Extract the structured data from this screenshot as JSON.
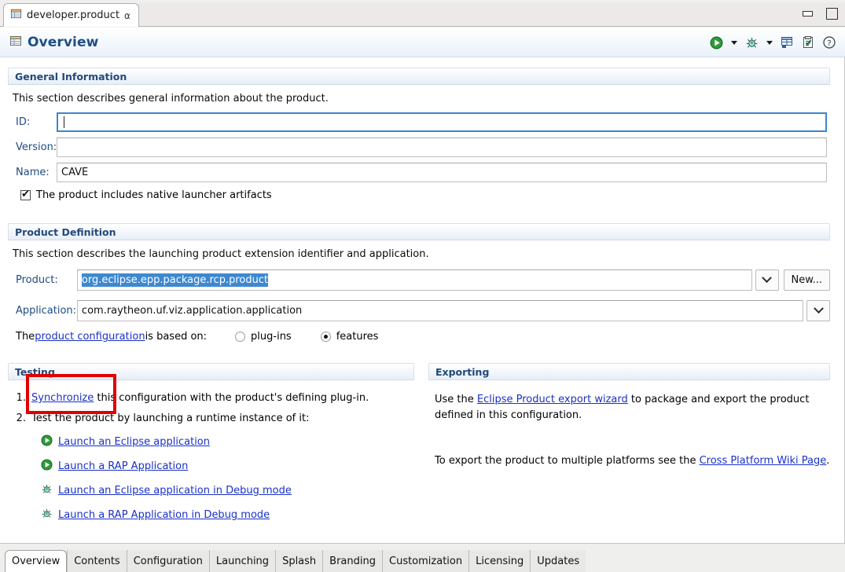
{
  "editor_tab": {
    "label": "developer.product",
    "icon": "product-file-icon",
    "close_icon": "close-icon"
  },
  "window": {
    "minimize_icon": "minimize-icon",
    "maximize_icon": "maximize-icon"
  },
  "form_header": {
    "title": "Overview",
    "icon": "overview-form-icon",
    "tools": [
      {
        "name": "run-icon",
        "type": "run"
      },
      {
        "name": "run-dropdown-arrow-icon",
        "type": "arrow"
      },
      {
        "name": "debug-icon",
        "type": "debug"
      },
      {
        "name": "debug-dropdown-arrow-icon",
        "type": "arrow"
      },
      {
        "name": "form-layout-icon",
        "type": "form"
      },
      {
        "name": "validate-icon",
        "type": "validate"
      },
      {
        "name": "help-icon",
        "type": "help"
      }
    ]
  },
  "general_information": {
    "title": "General Information",
    "description": "This section describes general information about the product.",
    "fields": {
      "id_label": "ID:",
      "id_value": "",
      "version_label": "Version:",
      "version_value": "",
      "name_label": "Name:",
      "name_value": "CAVE"
    },
    "checkbox": {
      "label": "The product includes native launcher artifacts",
      "checked": true
    }
  },
  "product_definition": {
    "title": "Product Definition",
    "description": "This section describes the launching product extension identifier and application.",
    "product_label": "Product:",
    "product_value": "org.eclipse.epp.package.rcp.product",
    "product_value_selected": true,
    "new_button": "New...",
    "application_label": "Application:",
    "application_value": "com.raytheon.uf.viz.application.application",
    "based_on_prefix": "The ",
    "based_on_link": "product configuration",
    "based_on_suffix": " is based on:",
    "radio_plugins": "plug-ins",
    "radio_features": "features",
    "radio_selected": "features"
  },
  "testing": {
    "title": "Testing",
    "step1_number": "1.",
    "step1_link": "Synchronize",
    "step1_text": " this configuration with the product's defining plug-in.",
    "step2_number": "2.",
    "step2_text": "Test the product by launching a runtime instance of it:",
    "launches": [
      {
        "label": "Launch an Eclipse application",
        "icon": "run-icon"
      },
      {
        "label": "Launch a RAP Application",
        "icon": "run-icon"
      },
      {
        "label": "Launch an Eclipse application in Debug mode",
        "icon": "debug-icon"
      },
      {
        "label": "Launch a RAP Application in Debug mode",
        "icon": "debug-icon"
      }
    ]
  },
  "exporting": {
    "title": "Exporting",
    "para1_prefix": "Use the ",
    "para1_link": "Eclipse Product export wizard",
    "para1_suffix": " to package and export the product",
    "para1_line2": "defined in this configuration.",
    "para2_prefix": "To export the product to multiple platforms see the ",
    "para2_link": "Cross Platform Wiki Page",
    "para2_suffix": "."
  },
  "annotation": {
    "color": "#e10000",
    "target": "Synchronize"
  },
  "page_tabs": [
    {
      "label": "Overview",
      "active": true
    },
    {
      "label": "Contents",
      "active": false
    },
    {
      "label": "Configuration",
      "active": false
    },
    {
      "label": "Launching",
      "active": false
    },
    {
      "label": "Splash",
      "active": false
    },
    {
      "label": "Branding",
      "active": false
    },
    {
      "label": "Customization",
      "active": false
    },
    {
      "label": "Licensing",
      "active": false
    },
    {
      "label": "Updates",
      "active": false
    }
  ],
  "colors": {
    "accent": "#1d4f85",
    "link": "#1a31c8",
    "selection": "#3d88d0",
    "annotation": "#e10000"
  }
}
